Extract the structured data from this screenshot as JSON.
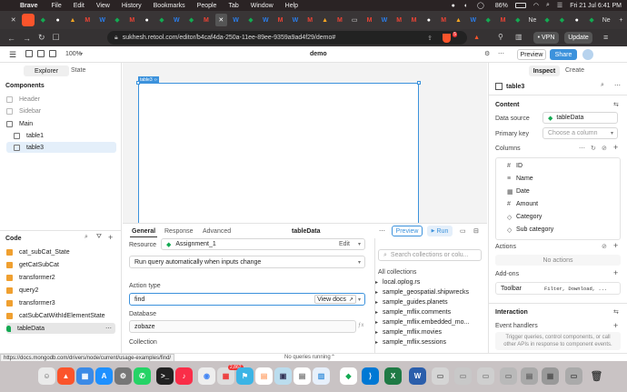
{
  "menubar": {
    "items": [
      "Brave",
      "File",
      "Edit",
      "View",
      "History",
      "Bookmarks",
      "People",
      "Tab",
      "Window",
      "Help"
    ],
    "battery": "86%",
    "clock": "Fri 21 Jul  6:41 PM"
  },
  "browser": {
    "url": "sukhesh.retool.com/editor/b4caf4da-250a-11ee-89ee-9359a9ad4f29/demo#",
    "vpn": "• VPN",
    "update": "Update",
    "shield_count": "5",
    "ne_tab": "Ne"
  },
  "editor": {
    "zoom": "100%",
    "app_name": "demo",
    "preview": "Preview",
    "share": "Share"
  },
  "left": {
    "tabs": [
      "Explorer",
      "State"
    ],
    "components_heading": "Components",
    "components": [
      "Header",
      "Sidebar",
      "Main",
      "table1",
      "table3"
    ],
    "code_heading": "Code",
    "code_items": [
      "cat_subCat_State",
      "getCatSubCat",
      "transformer2",
      "query2",
      "transformer3",
      "catSubCatWithIdElementState",
      "tableData"
    ]
  },
  "canvas": {
    "selected_label": "table3"
  },
  "query": {
    "tabs": [
      "General",
      "Response",
      "Advanced"
    ],
    "name": "tableData",
    "preview": "Preview",
    "run": "Run",
    "resource_label": "Resource",
    "resource": "Assignment_1",
    "edit": "Edit",
    "run_mode": "Run query automatically when inputs change",
    "action_type_label": "Action type",
    "action_type": "find",
    "view_docs": "View docs",
    "database_label": "Database",
    "database": "zobaze",
    "collection_label": "Collection",
    "search_placeholder": "Search collections or colu...",
    "all_collections": "All collections",
    "collections": [
      "local.oplog.rs",
      "sample_geospatial.shipwrecks",
      "sample_guides.planets",
      "sample_mflix.comments",
      "sample_mflix.embedded_mo...",
      "sample_mflix.movies",
      "sample_mflix.sessions"
    ]
  },
  "right": {
    "tabs": [
      "Inspect",
      "Create"
    ],
    "title": "table3",
    "content_heading": "Content",
    "data_source_label": "Data source",
    "data_source": "tableData",
    "primary_key_label": "Primary key",
    "primary_key_placeholder": "Choose a column",
    "columns_heading": "Columns",
    "columns": [
      "ID",
      "Name",
      "Date",
      "Amount",
      "Category",
      "Sub category"
    ],
    "actions_heading": "Actions",
    "no_actions": "No actions",
    "addons_heading": "Add-ons",
    "toolbar_label": "Toolbar",
    "toolbar_value": "Filter, Download, ...",
    "interaction_heading": "Interaction",
    "event_handlers": "Event handlers",
    "event_handlers_hint": "Trigger queries, control components, or call other APIs in response to component events."
  },
  "status": {
    "link": "https://docs.mongodb.com/drivers/node/current/usage-examples/find/",
    "queries": "No queries running"
  },
  "dock": {
    "badge": "2,862"
  },
  "colors": {
    "accent": "#3c92dc",
    "mongo": "#13aa52",
    "brave": "#fb542b"
  }
}
